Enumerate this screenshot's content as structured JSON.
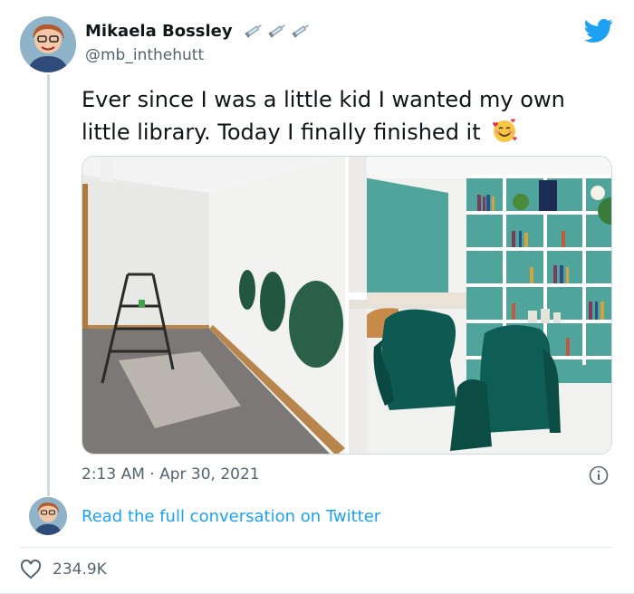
{
  "author": {
    "name": "Mikaela Bossley",
    "handle": "@mb_inthehutt",
    "name_emoji_icons": [
      "syringe-icon",
      "syringe-icon",
      "syringe-icon"
    ]
  },
  "tweet": {
    "text": "Ever since I was a little kid I wanted my own little library. Today I finally finished it",
    "emoji_icon": "smiling-face-with-hearts-icon",
    "timestamp": "2:13 AM · Apr 30, 2021"
  },
  "footer": {
    "read_more": "Read the full conversation on Twitter",
    "likes_count": "234.9K"
  },
  "colors": {
    "twitter_blue": "#1da1f2",
    "secondary_text": "#536471",
    "divider": "#e1e8ed"
  }
}
